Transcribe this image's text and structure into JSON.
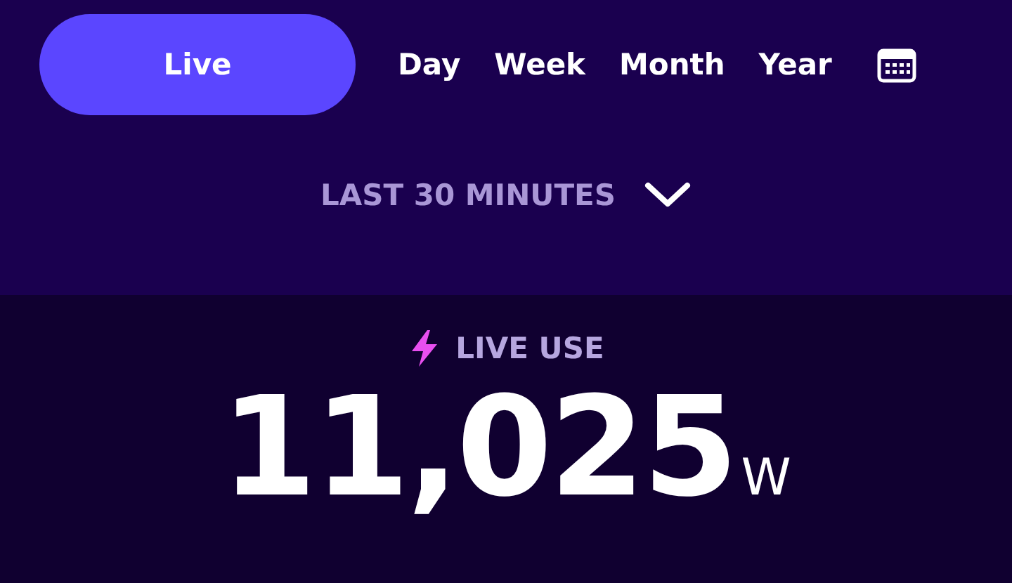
{
  "tabs": [
    {
      "label": "Live",
      "selected": true
    },
    {
      "label": "Day",
      "selected": false
    },
    {
      "label": "Week",
      "selected": false
    },
    {
      "label": "Month",
      "selected": false
    },
    {
      "label": "Year",
      "selected": false
    }
  ],
  "range": {
    "label": "LAST 30 MINUTES"
  },
  "live": {
    "label": "LIVE USE",
    "value": "11,025",
    "unit": "W"
  }
}
